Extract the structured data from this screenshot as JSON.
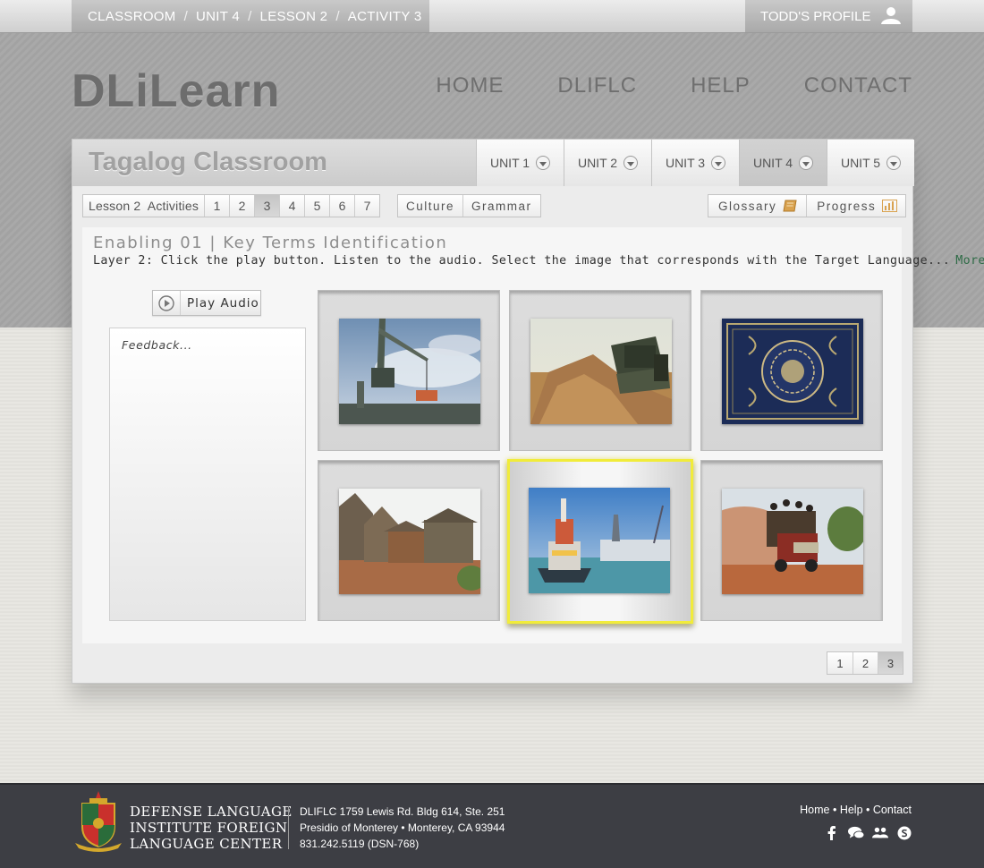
{
  "breadcrumb": {
    "items": [
      "CLASSROOM",
      "UNIT 4",
      "LESSON 2",
      "ACTIVITY 3"
    ],
    "separator": "/"
  },
  "profile": {
    "label": "TODD'S PROFILE",
    "icon": "user-icon"
  },
  "brand": {
    "logo_text": "DLiLearn"
  },
  "main_nav": {
    "items": [
      "HOME",
      "DLIFLC",
      "HELP",
      "CONTACT"
    ]
  },
  "classroom": {
    "title": "Tagalog Classroom",
    "unit_tabs": [
      {
        "label": "UNIT 1",
        "active": false
      },
      {
        "label": "UNIT 2",
        "active": false
      },
      {
        "label": "UNIT 3",
        "active": false
      },
      {
        "label": "UNIT 4",
        "active": true
      },
      {
        "label": "UNIT 5",
        "active": false
      }
    ]
  },
  "toolbar": {
    "lesson_label": "Lesson 2  Activities",
    "activity_numbers": [
      "1",
      "2",
      "3",
      "4",
      "5",
      "6",
      "7"
    ],
    "active_activity": "3",
    "culture_label": "Culture",
    "grammar_label": "Grammar",
    "glossary_label": "Glossary",
    "glossary_icon": "book-icon",
    "progress_label": "Progress",
    "progress_icon": "bar-chart-icon"
  },
  "activity": {
    "title": "Enabling 01 | Key Terms Identification",
    "instruction": "Layer 2: Click the play button. Listen to the audio. Select the image that corresponds with the Target Language...",
    "more_label": "More>>",
    "play_audio_label": "Play Audio",
    "feedback_placeholder": "Feedback...",
    "images": [
      {
        "subject": "crane",
        "selected": false
      },
      {
        "subject": "bulldozer",
        "selected": false
      },
      {
        "subject": "quran",
        "selected": false
      },
      {
        "subject": "huts",
        "selected": false
      },
      {
        "subject": "boat",
        "selected": true
      },
      {
        "subject": "truck",
        "selected": false
      }
    ]
  },
  "pagination": {
    "pages": [
      "1",
      "2",
      "3"
    ],
    "active_page": "3"
  },
  "footer": {
    "institution": [
      "DEFENSE LANGUAGE",
      "INSTITUTE FOREIGN",
      "LANGUAGE CENTER"
    ],
    "address": [
      "DLIFLC 1759 Lewis Rd. Bldg 614, Ste. 251",
      "Presidio of Monterey • Monterey, CA 93944",
      "831.242.5119 (DSN-768)"
    ],
    "links": [
      "Home",
      "Help",
      "Contact"
    ],
    "link_separator": "•",
    "social_icons": [
      "facebook-icon",
      "chat-icon",
      "group-icon",
      "skype-icon"
    ]
  },
  "colors": {
    "highlight": "#f1ec3a",
    "more_link": "#2e6b46",
    "footer_bg": "#3d3e44"
  }
}
